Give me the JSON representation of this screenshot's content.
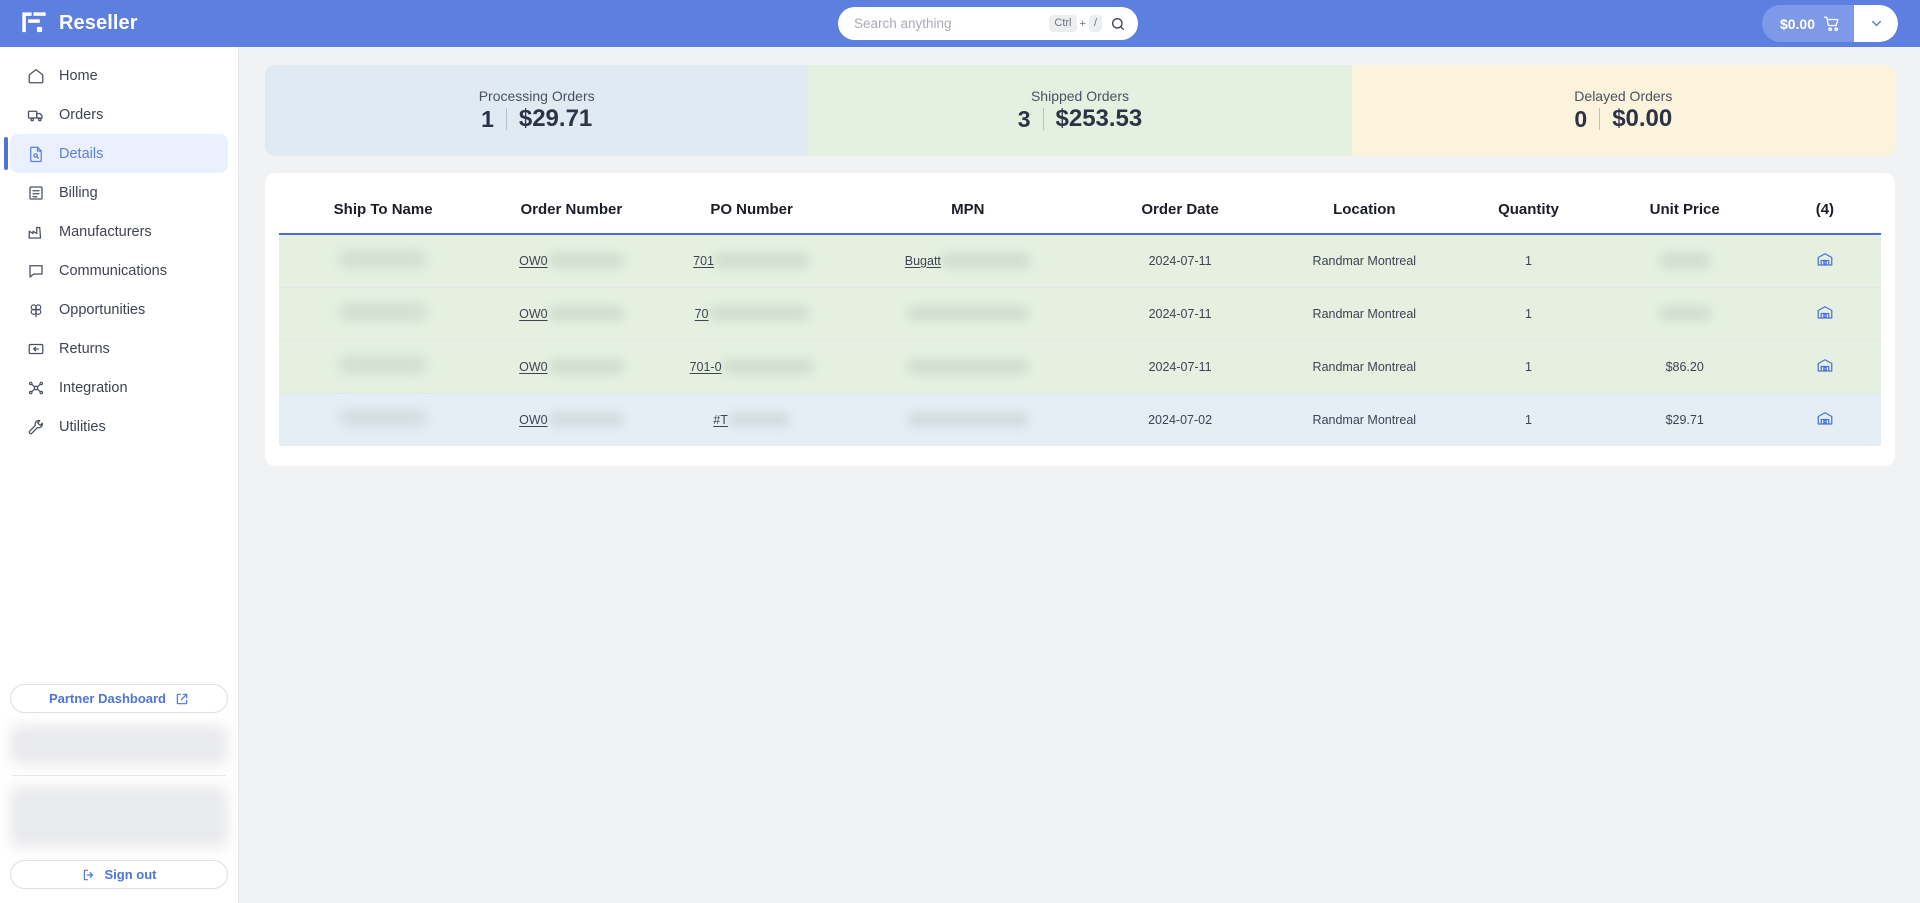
{
  "app": {
    "brand_name": "Reseller",
    "brand_logo_icon": "reseller-logo-icon"
  },
  "search": {
    "placeholder": "Search anything",
    "value": "",
    "shortcut_key": "Ctrl",
    "shortcut_plus": "+",
    "shortcut_slash": "/",
    "icon": "search-icon"
  },
  "cart": {
    "total": "$0.00",
    "icon": "shopping-cart-icon",
    "toggle_icon": "chevron-down-icon"
  },
  "sidebar": {
    "items": [
      {
        "label": "Home",
        "icon": "home-icon",
        "active": false
      },
      {
        "label": "Orders",
        "icon": "truck-icon",
        "active": false
      },
      {
        "label": "Details",
        "icon": "document-icon",
        "active": true
      },
      {
        "label": "Billing",
        "icon": "invoice-icon",
        "active": false
      },
      {
        "label": "Manufacturers",
        "icon": "factory-icon",
        "active": false
      },
      {
        "label": "Communications",
        "icon": "chat-icon",
        "active": false
      },
      {
        "label": "Opportunities",
        "icon": "clover-icon",
        "active": false
      },
      {
        "label": "Returns",
        "icon": "return-arrow-icon",
        "active": false
      },
      {
        "label": "Integration",
        "icon": "integration-icon",
        "active": false
      },
      {
        "label": "Utilities",
        "icon": "wrench-icon",
        "active": false
      }
    ],
    "partner_dashboard_label": "Partner Dashboard",
    "partner_dashboard_icon": "external-link-icon",
    "sign_out_label": "Sign out",
    "sign_out_icon": "sign-out-icon"
  },
  "stats": [
    {
      "label": "Processing Orders",
      "count": "1",
      "amount": "$29.71",
      "bg": "#dfeaf3"
    },
    {
      "label": "Shipped Orders",
      "count": "3",
      "amount": "$253.53",
      "bg": "#e5f1e0"
    },
    {
      "label": "Delayed Orders",
      "count": "0",
      "amount": "$0.00",
      "bg": "#fcf3dc"
    }
  ],
  "table": {
    "columns": [
      "Ship To Name",
      "Order Number",
      "PO Number",
      "MPN",
      "Order Date",
      "Location",
      "Quantity",
      "Unit Price",
      "(4)"
    ],
    "row_count_label": "(4)",
    "rows": [
      {
        "ship_to_name": "",
        "order_number": "OW0",
        "po_number": "701",
        "mpn": "Bugatt",
        "order_date": "2024-07-11",
        "location": "Randmar Montreal",
        "quantity": "1",
        "unit_price": "",
        "action_icon": "warehouse-icon",
        "status_color": "green"
      },
      {
        "ship_to_name": "",
        "order_number": "OW0",
        "po_number": "70",
        "mpn": "",
        "order_date": "2024-07-11",
        "location": "Randmar Montreal",
        "quantity": "1",
        "unit_price": "",
        "action_icon": "warehouse-icon",
        "status_color": "green"
      },
      {
        "ship_to_name": "",
        "order_number": "OW0",
        "po_number": "701-0",
        "mpn": "",
        "order_date": "2024-07-11",
        "location": "Randmar Montreal",
        "quantity": "1",
        "unit_price": "$86.20",
        "action_icon": "warehouse-icon",
        "status_color": "green"
      },
      {
        "ship_to_name": "",
        "order_number": "OW0",
        "po_number": "#T",
        "mpn": "",
        "order_date": "2024-07-02",
        "location": "Randmar Montreal",
        "quantity": "1",
        "unit_price": "$29.71",
        "action_icon": "warehouse-icon",
        "status_color": "blue"
      }
    ]
  },
  "colors": {
    "brand_blue": "#5c7fe0",
    "accent_blue": "#4d73dd",
    "row_green": "#e5f0e1",
    "row_blue": "#e6eef5",
    "page_bg": "#f1f2f4"
  }
}
